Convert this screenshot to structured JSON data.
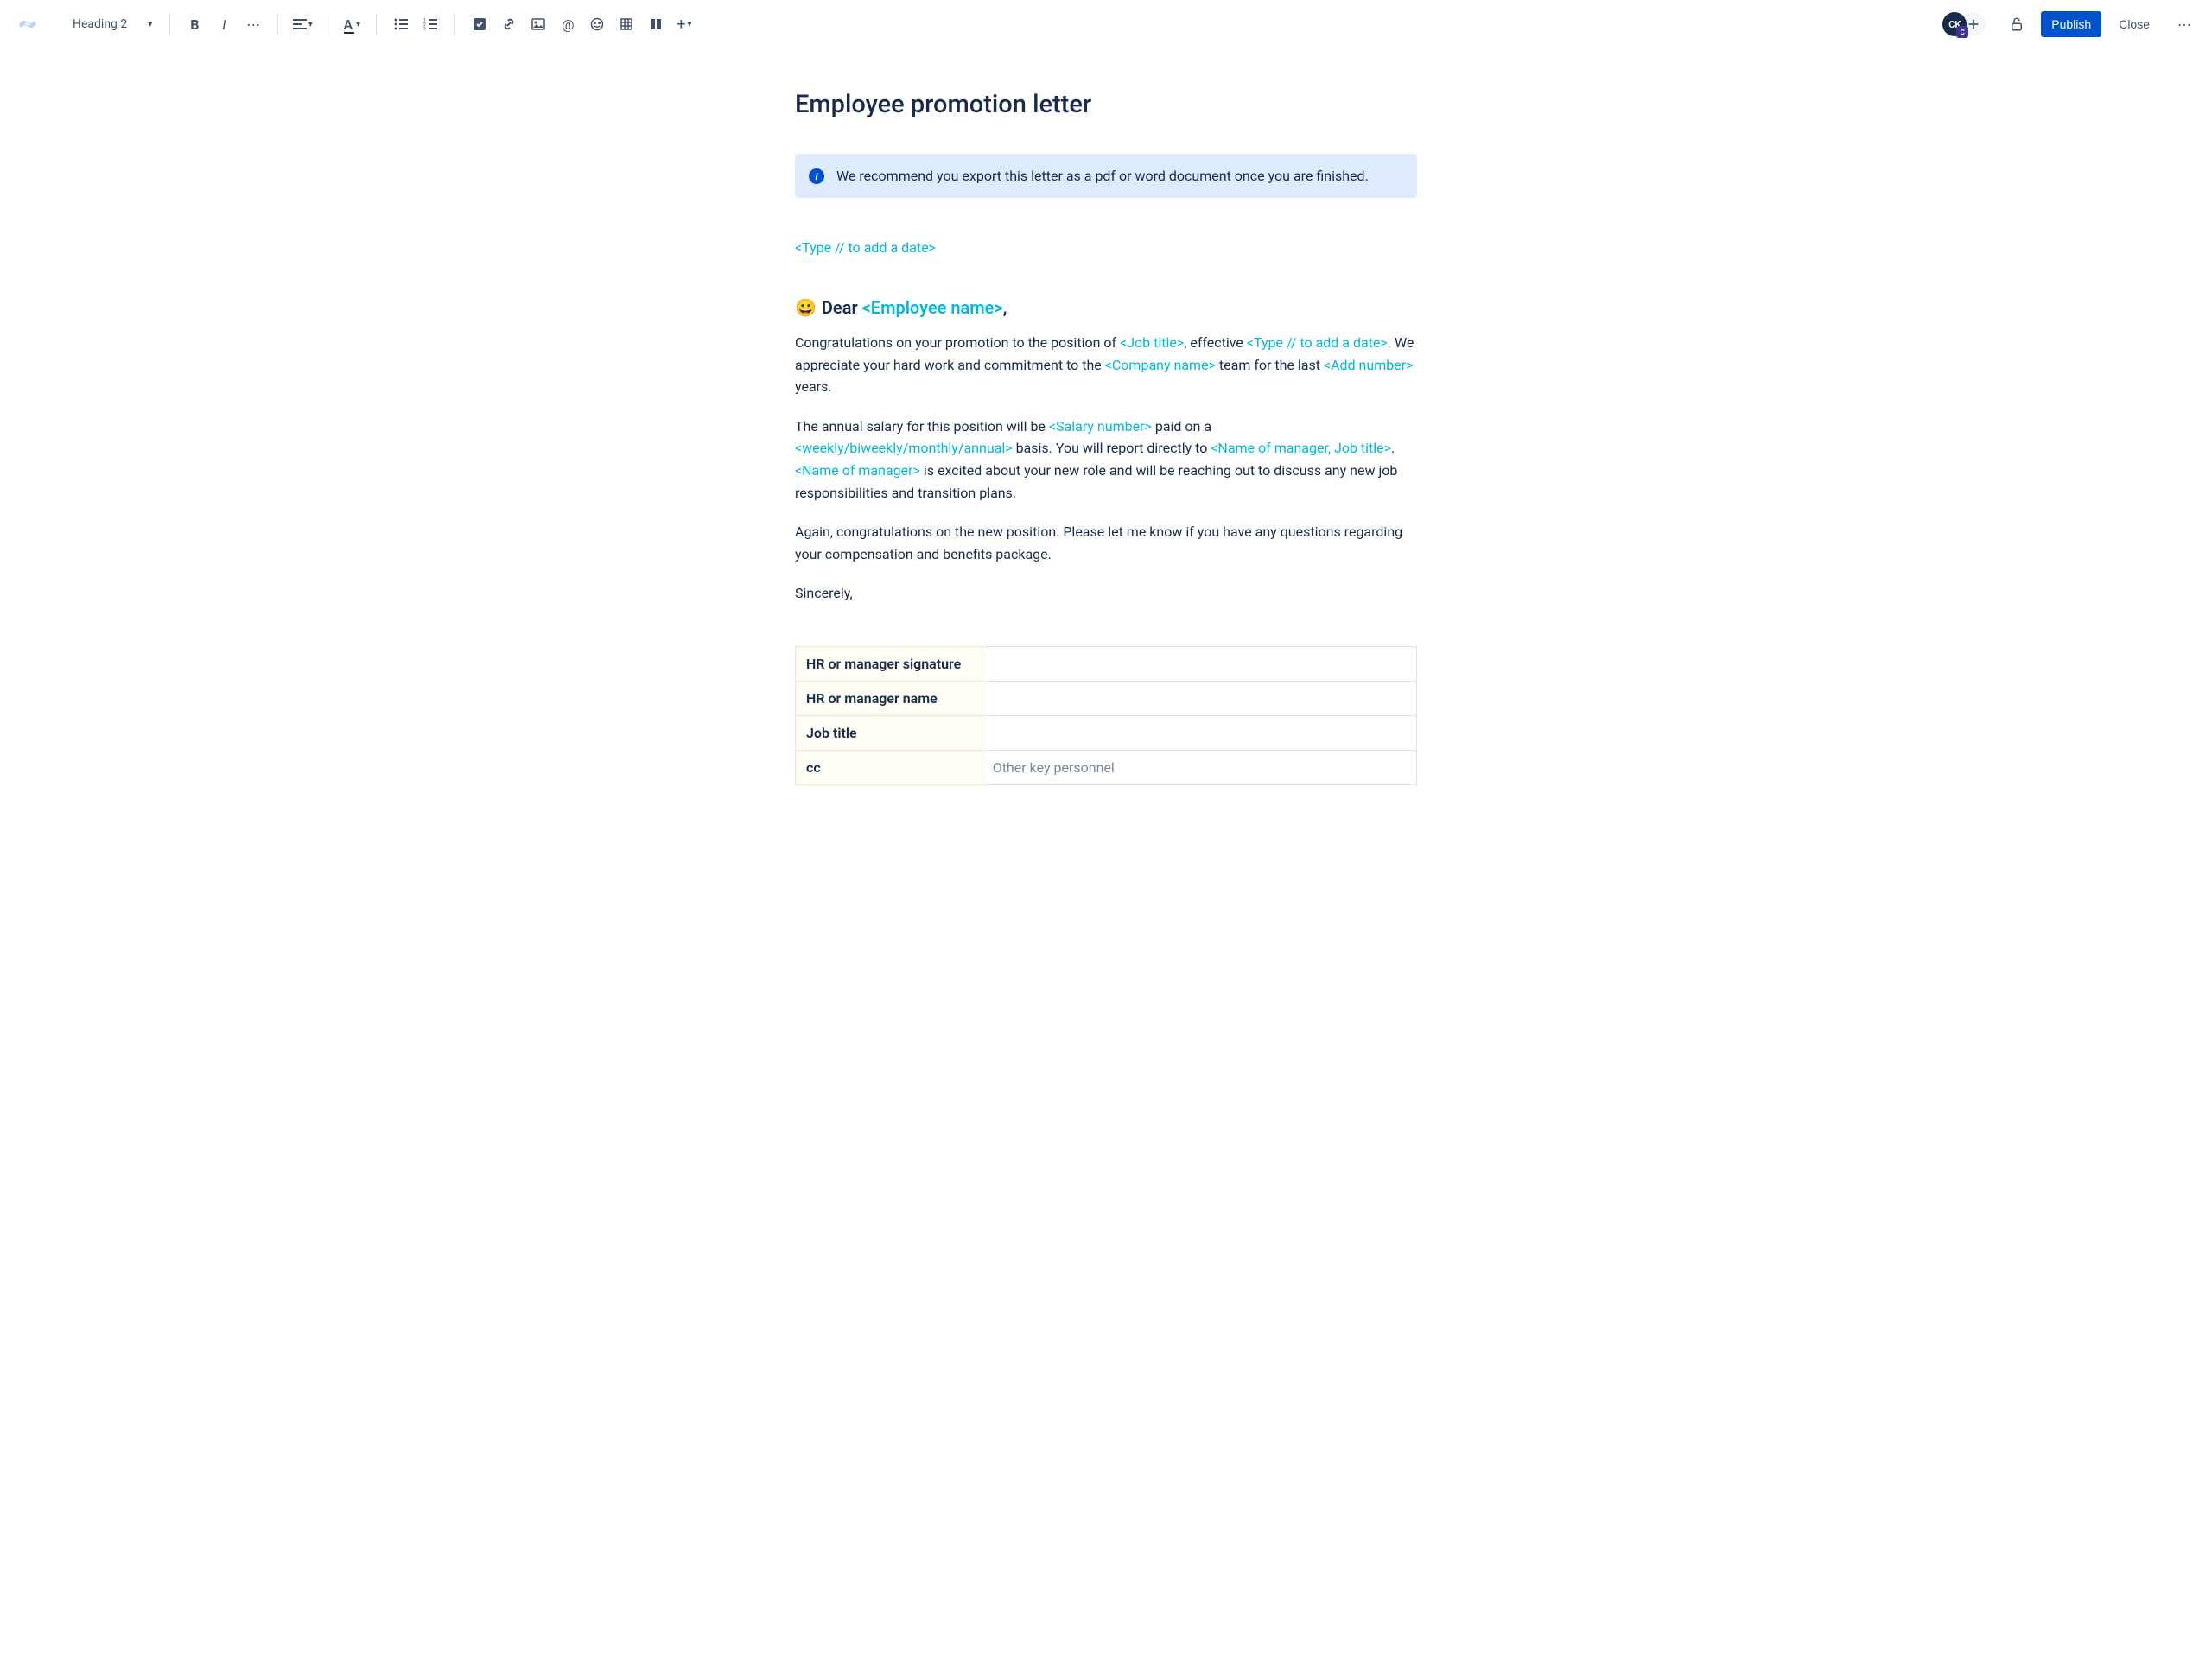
{
  "toolbar": {
    "heading_style": "Heading 2",
    "publish_label": "Publish",
    "close_label": "Close",
    "avatar_initials": "CK",
    "avatar_badge": "C"
  },
  "page": {
    "title": "Employee promotion letter",
    "info_panel": "We recommend you export this letter as a pdf or word document once you are finished.",
    "date_placeholder": "<Type // to add a date>",
    "greeting_emoji": "😀",
    "greeting_prefix": "Dear ",
    "greeting_name_ph": "<Employee name>",
    "greeting_suffix": ",",
    "p1_a": "Congratulations on your promotion to the position of ",
    "p1_job": "<Job title>",
    "p1_b": ", effective ",
    "p1_date": "<Type // to add a date>",
    "p1_c": ". We appreciate your hard work and commitment to the ",
    "p1_company": "<Company name>",
    "p1_d": " team for the last ",
    "p1_number": "<Add number>",
    "p1_e": " years.",
    "p2_a": "The annual salary for this position will be ",
    "p2_salary": "<Salary number>",
    "p2_b": " paid on a ",
    "p2_freq": "<weekly/biweekly/monthly/annual>",
    "p2_c": " basis. You will report directly to ",
    "p2_mgr1": "<Name of manager, Job title>",
    "p2_d": ". ",
    "p2_mgr2": "<Name of manager>",
    "p2_e": " is excited about your new role and will be reaching out to discuss any new job responsibilities and transition plans.",
    "p3": "Again, congratulations on the new position. Please let me know if you have any questions regarding your compensation and benefits package.",
    "p4": "Sincerely,",
    "table": {
      "rows": [
        {
          "label": "HR or manager signature",
          "value": ""
        },
        {
          "label": "HR or manager name",
          "value": ""
        },
        {
          "label": "Job title",
          "value": ""
        },
        {
          "label": "cc",
          "value": "Other key personnel"
        }
      ]
    }
  }
}
